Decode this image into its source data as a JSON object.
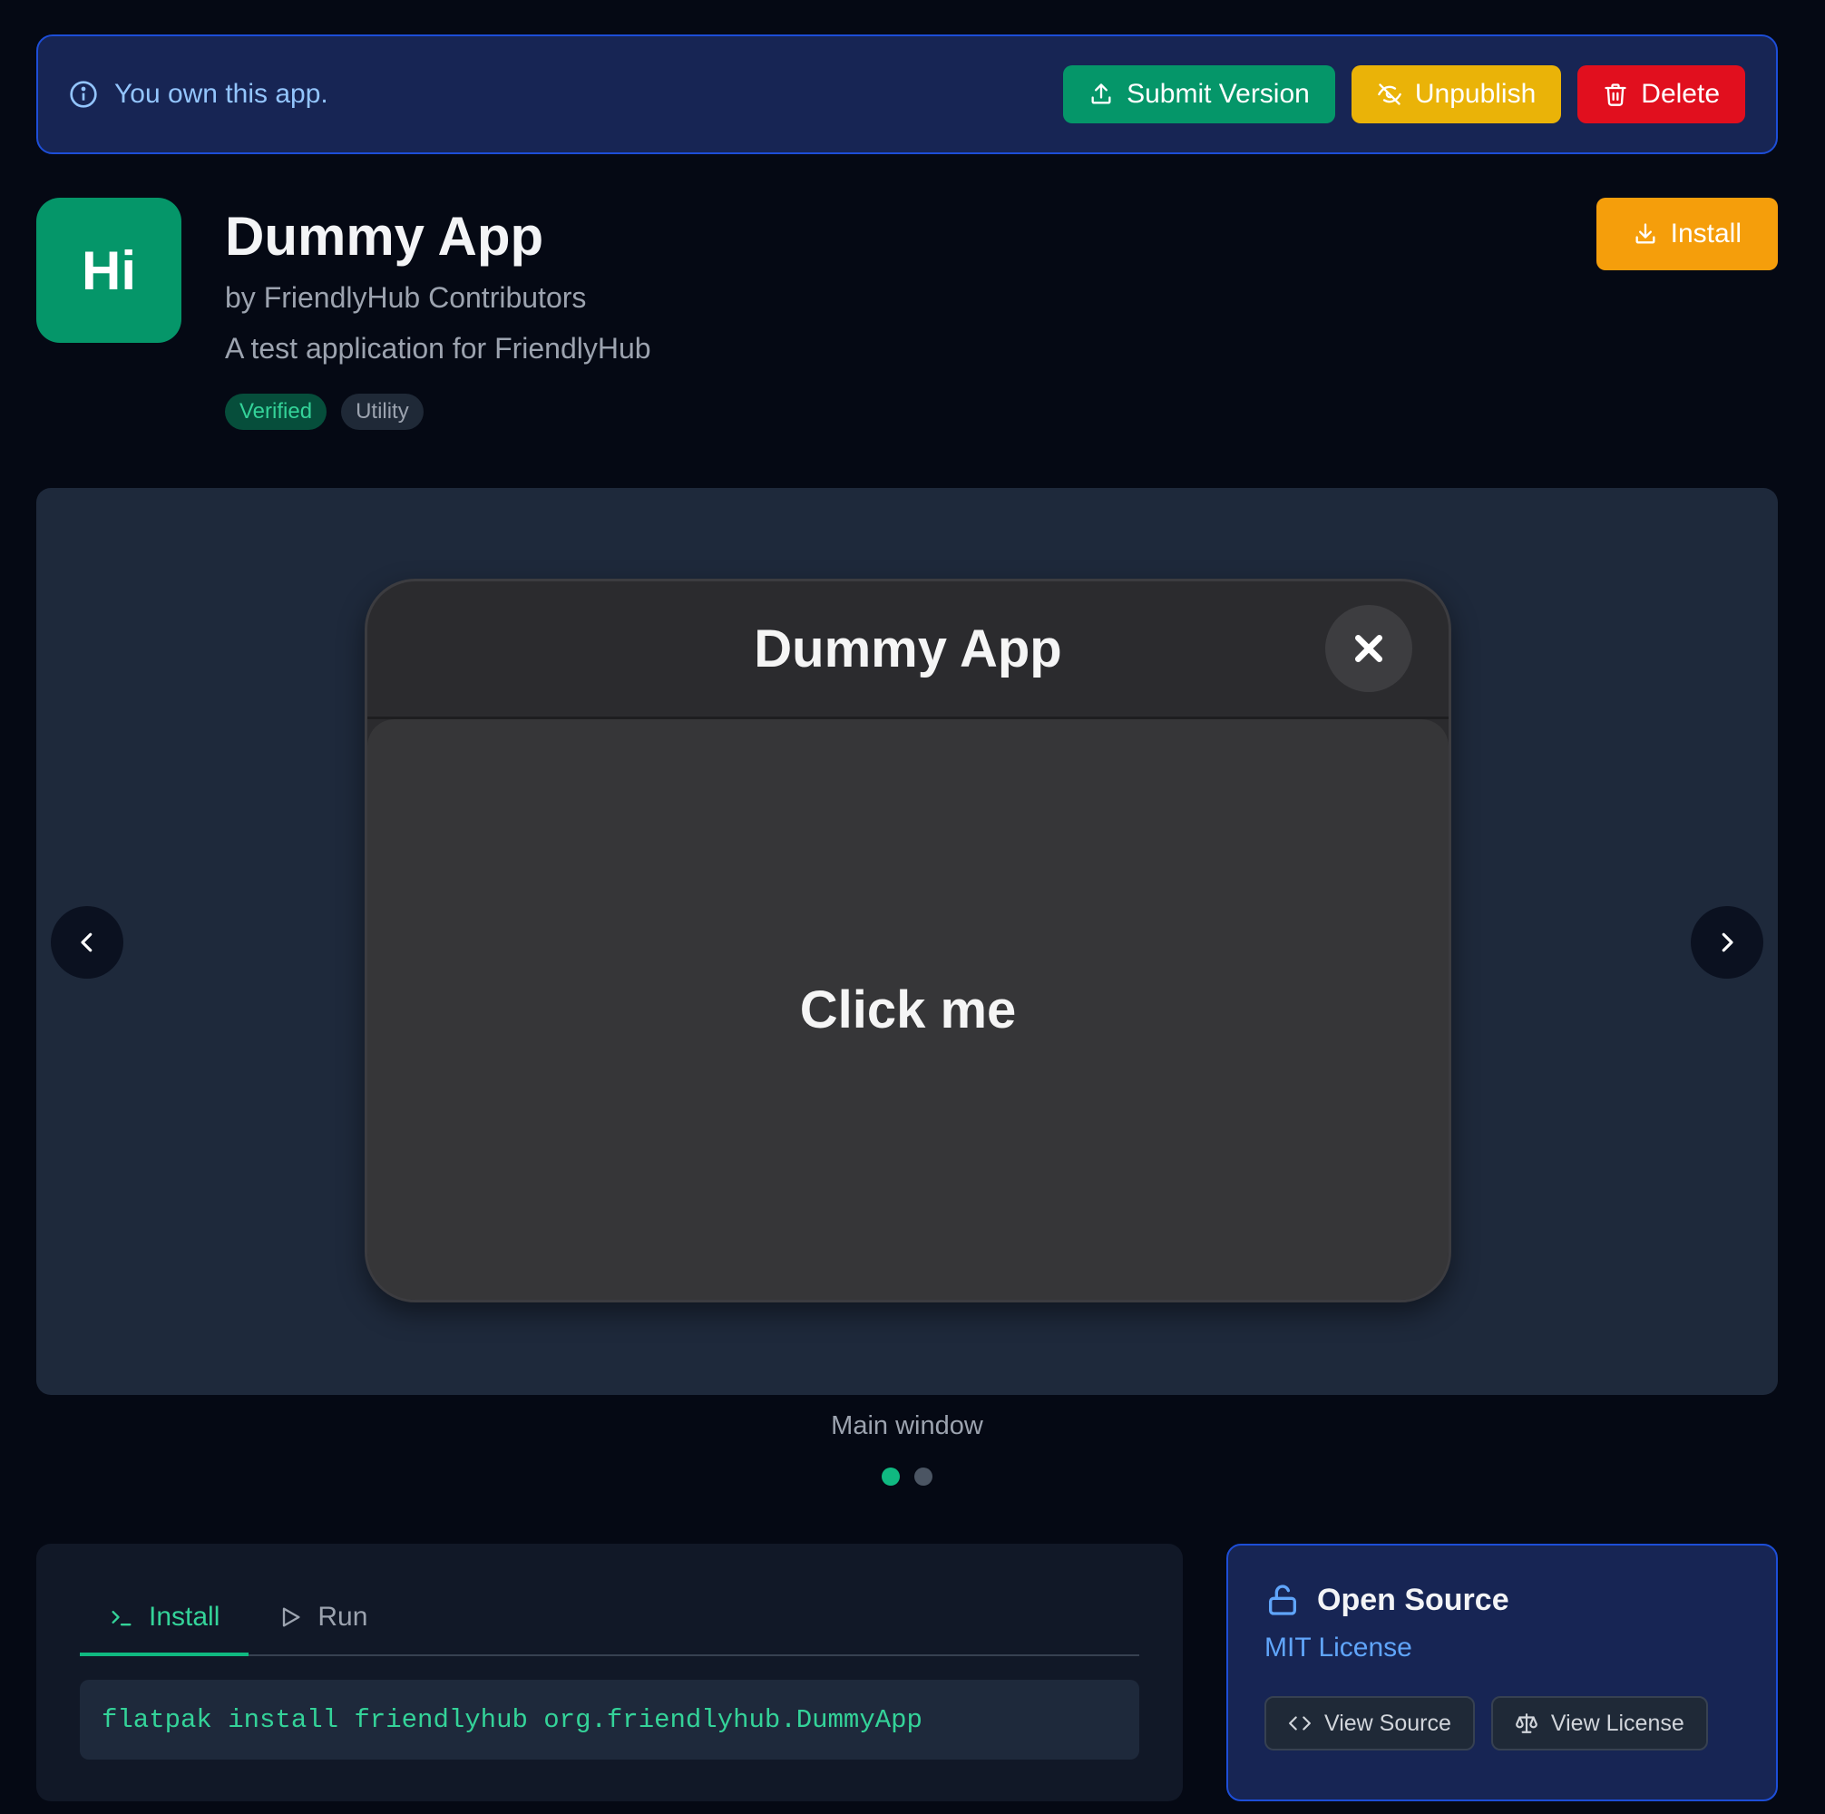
{
  "owner_banner": {
    "message": "You own this app.",
    "submit_label": "Submit Version",
    "unpublish_label": "Unpublish",
    "delete_label": "Delete"
  },
  "app": {
    "icon_text": "Hi",
    "name": "Dummy App",
    "author": "by FriendlyHub Contributors",
    "summary": "A test application for FriendlyHub",
    "badges": [
      "Verified",
      "Utility"
    ],
    "install_label": "Install"
  },
  "screenshot": {
    "window_title": "Dummy App",
    "button_label": "Click me",
    "caption": "Main window",
    "count": 2,
    "active_index": 0
  },
  "install_panel": {
    "tabs": [
      "Install",
      "Run"
    ],
    "active_tab": "Install",
    "command": "flatpak install friendlyhub org.friendlyhub.DummyApp"
  },
  "license_panel": {
    "heading": "Open Source",
    "license": "MIT License",
    "view_source_label": "View Source",
    "view_license_label": "View License"
  },
  "colors": {
    "accent_green": "#059669",
    "warning_yellow": "#eab308",
    "danger_red": "#e10f1e",
    "install_orange": "#f59e0b",
    "link_blue": "#60a5fa"
  },
  "icons": [
    "info-icon",
    "upload-icon",
    "eye-off-icon",
    "trash-icon",
    "download-icon",
    "close-icon",
    "chevron-left-icon",
    "chevron-right-icon",
    "terminal-icon",
    "play-icon",
    "unlock-icon",
    "code-icon",
    "scale-icon"
  ]
}
